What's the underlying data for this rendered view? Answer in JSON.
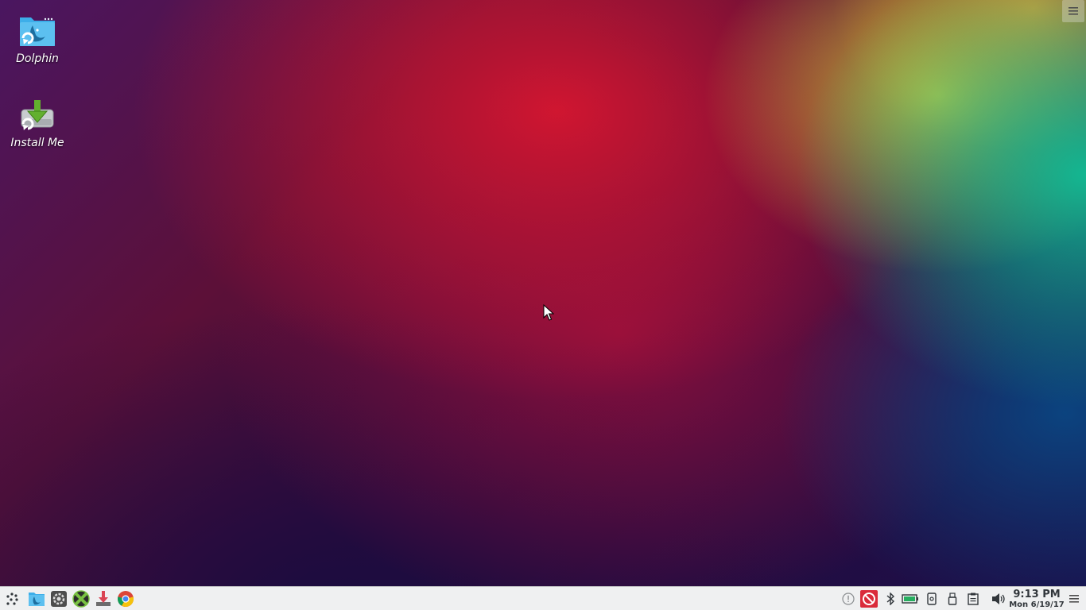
{
  "desktop": {
    "icons": [
      {
        "label": "Dolphin",
        "icon": "dolphin-file-manager-icon"
      },
      {
        "label": "Install Me",
        "icon": "install-me-icon"
      }
    ]
  },
  "corner_menu": {
    "icon": "hamburger-menu-icon"
  },
  "taskbar": {
    "launchers": [
      {
        "icon": "application-launcher-icon"
      },
      {
        "icon": "dolphin-file-manager-icon"
      },
      {
        "icon": "system-settings-icon"
      },
      {
        "icon": "crossover-icon"
      },
      {
        "icon": "download-installer-icon"
      },
      {
        "icon": "google-chrome-icon"
      }
    ],
    "tray": [
      {
        "icon": "notifications-icon"
      },
      {
        "icon": "blocked-app-icon"
      },
      {
        "icon": "bluetooth-icon"
      },
      {
        "icon": "battery-icon"
      },
      {
        "icon": "kde-connect-icon"
      },
      {
        "icon": "usb-device-icon"
      },
      {
        "icon": "clipboard-icon"
      },
      {
        "icon": "volume-icon"
      }
    ],
    "clock": {
      "time": "9:13 PM",
      "date": "Mon 6/19/17"
    },
    "menu": {
      "icon": "hamburger-menu-icon"
    }
  },
  "colors": {
    "panel_bg": "#eff0f1",
    "panel_text": "#31363b",
    "dolphin_blue": "#3daee9",
    "install_green": "#62b02e"
  }
}
